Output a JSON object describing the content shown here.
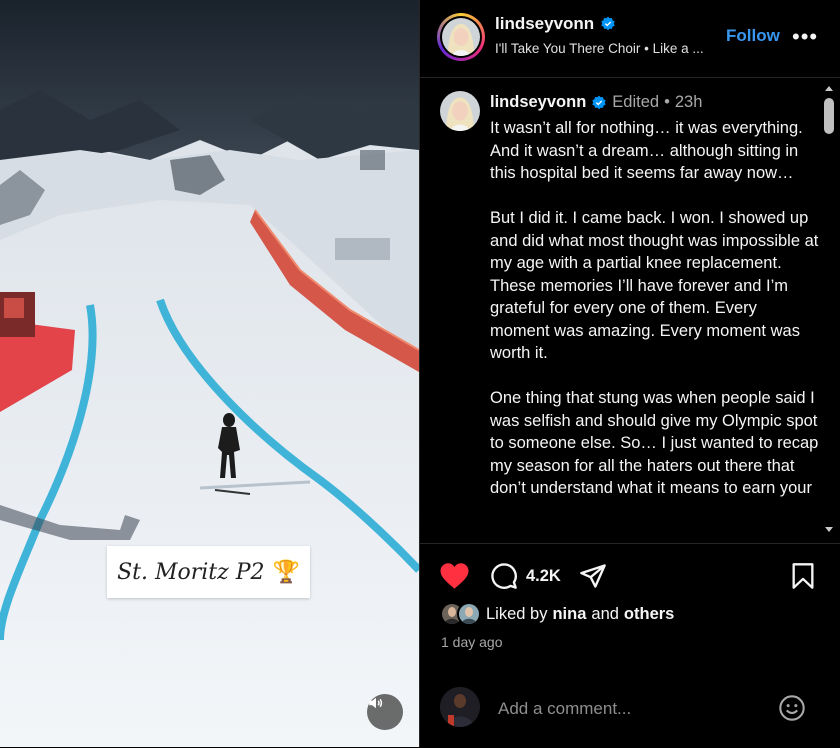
{
  "media": {
    "caption": "St. Moritz P2",
    "caption_emoji": "🏆",
    "mute_icon": "speaker-icon"
  },
  "header": {
    "username": "lindseyvonn",
    "subtitle": "I'll Take You There Choir • Like a ...",
    "follow_label": "Follow",
    "more_label": "•••"
  },
  "post": {
    "username": "lindseyvonn",
    "edited_label": "Edited",
    "separator": "•",
    "time": "23h",
    "paragraphs": [
      "It wasn’t all for nothing… it was everything. And it wasn’t a dream… although sitting in this hospital bed it seems far away now…",
      "But I did it. I came back. I won. I showed up and did what most thought was impossible at my age with a partial knee replacement. These memories I’ll have forever and I’m grateful for every one of them. Every moment was amazing. Every moment was worth it.",
      "One thing that stung was when people said I was selfish and should give my Olympic spot to someone else. So… I just wanted to recap my season for all the haters out there that don’t understand what it means to earn your"
    ]
  },
  "actions": {
    "comment_count": "4.2K",
    "liked_prefix": "Liked by",
    "liked_user": "nina",
    "liked_and": "and",
    "liked_others": "others",
    "time_ago": "1 day ago"
  },
  "comment_box": {
    "placeholder": "Add a comment..."
  },
  "colors": {
    "accent": "#3897f0",
    "like_red": "#ff3040",
    "background": "#000000"
  }
}
